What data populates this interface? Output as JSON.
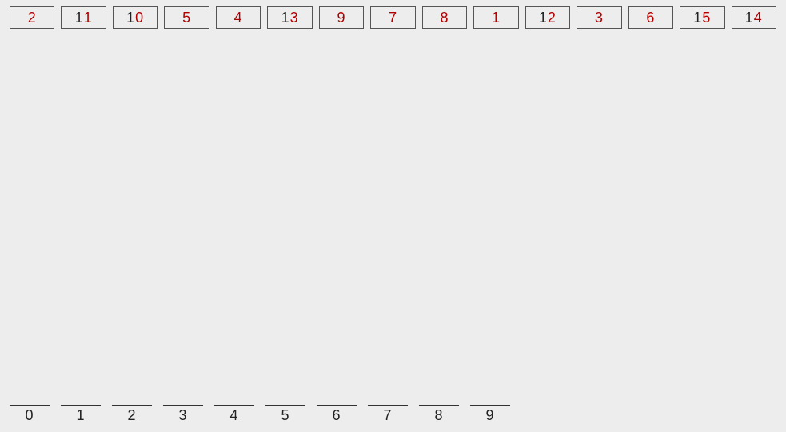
{
  "colors": {
    "bg": "#ededed",
    "border": "#555",
    "black": "#222",
    "red": "#b00000"
  },
  "cards": [
    {
      "digits": [
        {
          "ch": "2",
          "color": "red"
        }
      ]
    },
    {
      "digits": [
        {
          "ch": "1",
          "color": "black"
        },
        {
          "ch": "1",
          "color": "red"
        }
      ]
    },
    {
      "digits": [
        {
          "ch": "1",
          "color": "black"
        },
        {
          "ch": "0",
          "color": "red"
        }
      ]
    },
    {
      "digits": [
        {
          "ch": "5",
          "color": "red"
        }
      ]
    },
    {
      "digits": [
        {
          "ch": "4",
          "color": "red"
        }
      ]
    },
    {
      "digits": [
        {
          "ch": "1",
          "color": "black"
        },
        {
          "ch": "3",
          "color": "red"
        }
      ]
    },
    {
      "digits": [
        {
          "ch": "9",
          "color": "red"
        }
      ]
    },
    {
      "digits": [
        {
          "ch": "7",
          "color": "red"
        }
      ]
    },
    {
      "digits": [
        {
          "ch": "8",
          "color": "red"
        }
      ]
    },
    {
      "digits": [
        {
          "ch": "1",
          "color": "red"
        }
      ]
    },
    {
      "digits": [
        {
          "ch": "1",
          "color": "black"
        },
        {
          "ch": "2",
          "color": "red"
        }
      ]
    },
    {
      "digits": [
        {
          "ch": "3",
          "color": "red"
        }
      ]
    },
    {
      "digits": [
        {
          "ch": "6",
          "color": "red"
        }
      ]
    },
    {
      "digits": [
        {
          "ch": "1",
          "color": "black"
        },
        {
          "ch": "5",
          "color": "red"
        }
      ]
    },
    {
      "digits": [
        {
          "ch": "1",
          "color": "black"
        },
        {
          "ch": "4",
          "color": "red"
        }
      ]
    }
  ],
  "bins": [
    "0",
    "1",
    "2",
    "3",
    "4",
    "5",
    "6",
    "7",
    "8",
    "9"
  ],
  "chart_data": {
    "type": "table",
    "series": [
      {
        "name": "card-values-top-row",
        "values": [
          2,
          11,
          10,
          5,
          4,
          13,
          9,
          7,
          8,
          1,
          12,
          3,
          6,
          15,
          14
        ]
      },
      {
        "name": "bin-labels-bottom-row",
        "values": [
          0,
          1,
          2,
          3,
          4,
          5,
          6,
          7,
          8,
          9
        ]
      }
    ]
  }
}
